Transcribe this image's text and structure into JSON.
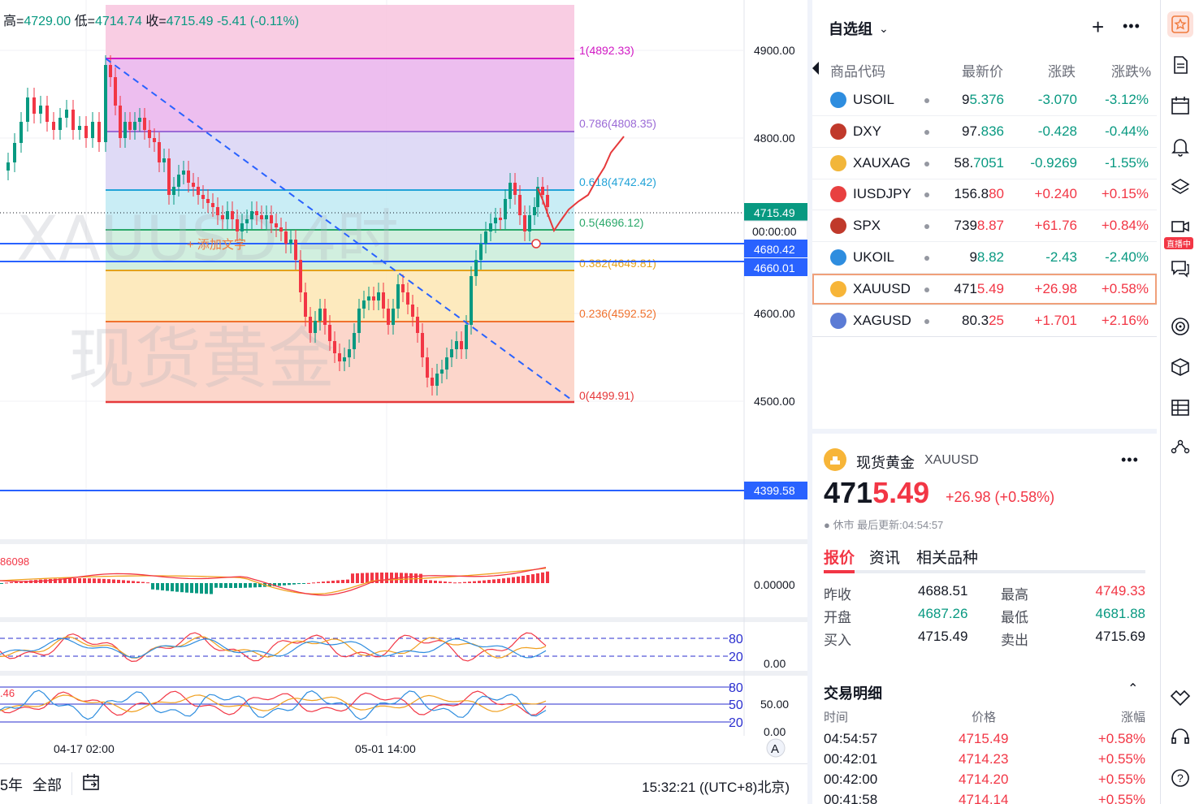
{
  "ohlc": {
    "high_label": "高=",
    "high": "4729.00",
    "low_label": "低=",
    "low": "4714.74",
    "close_label": "收=",
    "close": "4715.49",
    "change": "-5.41 (-0.11%)"
  },
  "watermark": {
    "line1": "XAUUSD 4时",
    "line2": "现货黄金"
  },
  "price_axis": {
    "ticks": [
      "4900.00",
      "4800.00",
      "4600.00",
      "4500.00"
    ],
    "last_price": "4715.49",
    "countdown": "00:00:00",
    "line1": "4680.42",
    "line2": "4660.01",
    "line3": "4399.58"
  },
  "fib": {
    "levels": [
      {
        "label": "1(4892.33)",
        "color": "#d119c4"
      },
      {
        "label": "0.786(4808.35)",
        "color": "#9b6ad6"
      },
      {
        "label": "0.618(4742.42)",
        "color": "#22a3d8"
      },
      {
        "label": "0.5(4696.12)",
        "color": "#2aa86a"
      },
      {
        "label": "0.382(4649.81)",
        "color": "#e3a21c"
      },
      {
        "label": "0.236(4592.52)",
        "color": "#f0722e"
      },
      {
        "label": "0(4499.91)",
        "color": "#e6393b"
      }
    ]
  },
  "add_text_hint": "+ 添加文字",
  "indicators": {
    "macd_value": "86098",
    "macd_axis": "0.00000",
    "stoch_80": "80",
    "stoch_20": "20",
    "stoch_axis": "0.00",
    "rsi_value": ".46",
    "rsi_80": "80",
    "rsi_50": "50",
    "rsi_20": "20",
    "rsi_axis_50": "50.00",
    "rsi_axis_0": "0.00"
  },
  "time_axis": {
    "t1": "04-17 02:00",
    "t2": "05-01 14:00",
    "auto": "A"
  },
  "bottom_toolbar": {
    "range_5y": "5年",
    "range_all": "全部",
    "clock": "15:32:21 ((UTC+8)北京)"
  },
  "watchlist": {
    "title": "自选组",
    "col_symbol": "商品代码",
    "col_last": "最新价",
    "col_change": "涨跌",
    "col_pct": "涨跌%",
    "rows": [
      {
        "sym": "USOIL",
        "last_a": "9",
        "last_b": "5.376",
        "chg": "-3.070",
        "pct": "-3.12%",
        "dir": "down",
        "icon_color": "#2e8ddf"
      },
      {
        "sym": "DXY",
        "last_a": "97.",
        "last_b": "836",
        "chg": "-0.428",
        "pct": "-0.44%",
        "dir": "down",
        "icon_color": "#c0392b"
      },
      {
        "sym": "XAUXAG",
        "last_a": "58.",
        "last_b": "7051",
        "chg": "-0.9269",
        "pct": "-1.55%",
        "dir": "down",
        "icon_color": "#f2b63a"
      },
      {
        "sym": "IUSDJPY",
        "last_a": "156.8",
        "last_b": "80",
        "chg": "+0.240",
        "pct": "+0.15%",
        "dir": "up",
        "icon_color": "#e84040"
      },
      {
        "sym": "SPX",
        "last_a": "739",
        "last_b": "8.87",
        "chg": "+61.76",
        "pct": "+0.84%",
        "dir": "up",
        "icon_color": "#c0392b"
      },
      {
        "sym": "UKOIL",
        "last_a": "9",
        "last_b": "8.82",
        "chg": "-2.43",
        "pct": "-2.40%",
        "dir": "down",
        "icon_color": "#2e8ddf"
      },
      {
        "sym": "XAUUSD",
        "last_a": "471",
        "last_b": "5.49",
        "chg": "+26.98",
        "pct": "+0.58%",
        "dir": "up",
        "icon_color": "#f7b538"
      },
      {
        "sym": "XAGUSD",
        "last_a": "80.3",
        "last_b": "25",
        "chg": "+1.701",
        "pct": "+2.16%",
        "dir": "up",
        "icon_color": "#5b7bd5"
      }
    ]
  },
  "detail": {
    "name": "现货黄金",
    "code": "XAUUSD",
    "price_a": "471",
    "price_b": "5.49",
    "change": "+26.98 (+0.58%)",
    "status": "● 休市 最后更新:04:54:57",
    "tabs": [
      "报价",
      "资讯",
      "相关品种"
    ],
    "quote": [
      {
        "k1": "昨收",
        "v1": "4688.51",
        "k2": "最高",
        "v2": "4749.33",
        "c1": "neutral",
        "c2": "up"
      },
      {
        "k1": "开盘",
        "v1": "4687.26",
        "k2": "最低",
        "v2": "4681.88",
        "c1": "down",
        "c2": "down"
      },
      {
        "k1": "买入",
        "v1": "4715.49",
        "k2": "卖出",
        "v2": "4715.69",
        "c1": "neutral",
        "c2": "neutral"
      }
    ],
    "trades_title": "交易明细",
    "trades_head": {
      "time": "时间",
      "price": "价格",
      "pct": "涨幅"
    },
    "trades": [
      {
        "time": "04:54:57",
        "price": "4715.49",
        "pct": "+0.58%"
      },
      {
        "time": "00:42:01",
        "price": "4714.23",
        "pct": "+0.55%"
      },
      {
        "time": "00:42:00",
        "price": "4714.20",
        "pct": "+0.55%"
      },
      {
        "time": "00:41:58",
        "price": "4714.14",
        "pct": "+0.55%"
      }
    ]
  },
  "side_badge": "直播中",
  "colors": {
    "up": "#f23645",
    "down": "#089981",
    "accent_blue": "#2962ff"
  }
}
